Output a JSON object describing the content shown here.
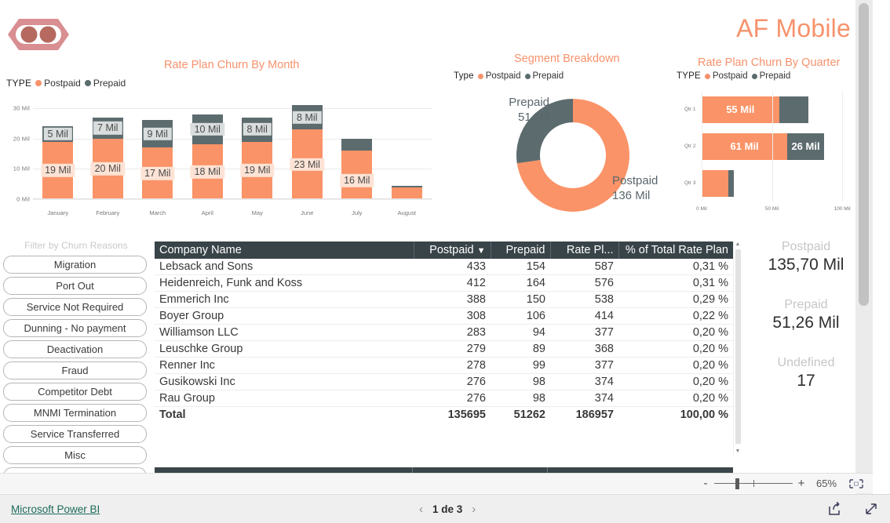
{
  "brand": {
    "title": "AF Mobile",
    "logo_icon": "af-mobile-logo-icon"
  },
  "charts": {
    "column": {
      "title": "Rate Plan Churn By Month",
      "legend_caption": "TYPE",
      "legend": [
        "Postpaid",
        "Prepaid"
      ]
    },
    "donut": {
      "title": "Segment Breakdown",
      "legend_caption": "Type",
      "legend": [
        "Postpaid",
        "Prepaid"
      ],
      "callout_left_name": "Prepaid",
      "callout_left_value": "51 Mil",
      "callout_right_name": "Postpaid",
      "callout_right_value": "136 Mil"
    },
    "quarter": {
      "title": "Rate Plan Churn By Quarter",
      "legend_caption": "TYPE",
      "legend": [
        "Postpaid",
        "Prepaid"
      ]
    }
  },
  "chart_data": [
    {
      "type": "bar",
      "name": "rate-plan-churn-by-month",
      "title": "Rate Plan Churn By Month",
      "stacked": true,
      "orientation": "vertical",
      "categories": [
        "January",
        "February",
        "March",
        "April",
        "May",
        "June",
        "July",
        "August"
      ],
      "series": [
        {
          "name": "Postpaid",
          "color": "#FA9367",
          "values": [
            19,
            20,
            17,
            18,
            19,
            23,
            16,
            4
          ],
          "labels": [
            "19 Mil",
            "20 Mil",
            "17 Mil",
            "18 Mil",
            "19 Mil",
            "23 Mil",
            "16 Mil",
            ""
          ]
        },
        {
          "name": "Prepaid",
          "color": "#5C6B6E",
          "values": [
            5,
            7,
            9,
            10,
            8,
            8,
            4,
            0.4
          ],
          "labels": [
            "5 Mil",
            "7 Mil",
            "9 Mil",
            "10 Mil",
            "8 Mil",
            "8 Mil",
            "",
            ""
          ]
        }
      ],
      "ylabel": "",
      "xlabel": "",
      "ylim": [
        0,
        30
      ],
      "yticks": [
        0,
        10,
        20,
        30
      ],
      "ytick_labels": [
        "0 Mil",
        "10 Mil",
        "20 Mil",
        "30 Mil"
      ],
      "grid": true,
      "legend_position": "top-left"
    },
    {
      "type": "pie",
      "name": "segment-breakdown",
      "title": "Segment Breakdown",
      "donut": true,
      "labels": [
        "Postpaid",
        "Prepaid"
      ],
      "values": [
        136,
        51
      ],
      "value_labels": [
        "136 Mil",
        "51 Mil"
      ],
      "colors": [
        "#FA9367",
        "#5C6B6E"
      ],
      "legend_position": "top-left"
    },
    {
      "type": "bar",
      "name": "rate-plan-churn-by-quarter",
      "title": "Rate Plan Churn By Quarter",
      "stacked": true,
      "orientation": "horizontal",
      "categories": [
        "Qtr 1",
        "Qtr 2",
        "Qtr 3"
      ],
      "series": [
        {
          "name": "Postpaid",
          "color": "#FA9367",
          "values": [
            55,
            61,
            19
          ],
          "labels": [
            "55 Mil",
            "61 Mil",
            ""
          ]
        },
        {
          "name": "Prepaid",
          "color": "#5C6B6E",
          "values": [
            21,
            26,
            4
          ],
          "labels": [
            "",
            "26 Mil",
            ""
          ]
        }
      ],
      "xlim": [
        0,
        110
      ],
      "xticks": [
        0,
        50,
        100
      ],
      "xtick_labels": [
        "0 Mil",
        "50 Mil",
        "100 Mil"
      ],
      "grid": true,
      "legend_position": "top-left"
    }
  ],
  "slicer": {
    "title": "Filter by Churn Reasons",
    "items": [
      "Migration",
      "Port Out",
      "Service Not Required",
      "Dunning - No payment",
      "Deactivation",
      "Fraud",
      "Competitor Debt",
      "MNMI Termination",
      "Service Transferred",
      "Misc"
    ]
  },
  "table": {
    "columns": [
      "Company Name",
      "Postpaid",
      "Prepaid",
      "Rate Pl...",
      "% of Total Rate Plan"
    ],
    "sorted_column": "Postpaid",
    "sort_direction": "desc",
    "rows": [
      {
        "company": "Lebsack and Sons",
        "postpaid": "433",
        "prepaid": "154",
        "rateplan": "587",
        "pct": "0,31 %"
      },
      {
        "company": "Heidenreich, Funk and Koss",
        "postpaid": "412",
        "prepaid": "164",
        "rateplan": "576",
        "pct": "0,31 %"
      },
      {
        "company": "Emmerich Inc",
        "postpaid": "388",
        "prepaid": "150",
        "rateplan": "538",
        "pct": "0,29 %"
      },
      {
        "company": "Boyer Group",
        "postpaid": "308",
        "prepaid": "106",
        "rateplan": "414",
        "pct": "0,22 %"
      },
      {
        "company": "Williamson LLC",
        "postpaid": "283",
        "prepaid": "94",
        "rateplan": "377",
        "pct": "0,20 %"
      },
      {
        "company": "Leuschke Group",
        "postpaid": "279",
        "prepaid": "89",
        "rateplan": "368",
        "pct": "0,20 %"
      },
      {
        "company": "Renner Inc",
        "postpaid": "278",
        "prepaid": "99",
        "rateplan": "377",
        "pct": "0,20 %"
      },
      {
        "company": "Gusikowski Inc",
        "postpaid": "276",
        "prepaid": "98",
        "rateplan": "374",
        "pct": "0,20 %"
      },
      {
        "company": "Rau Group",
        "postpaid": "276",
        "prepaid": "98",
        "rateplan": "374",
        "pct": "0,20 %"
      }
    ],
    "total": {
      "company": "Total",
      "postpaid": "135695",
      "prepaid": "51262",
      "rateplan": "186957",
      "pct": "100,00 %"
    }
  },
  "kpis": [
    {
      "label": "Postpaid",
      "value": "135,70 Mil"
    },
    {
      "label": "Prepaid",
      "value": "51,26 Mil"
    },
    {
      "label": "Undefined",
      "value": "17"
    }
  ],
  "zoombar": {
    "minus": "-",
    "plus": "+",
    "percent": "65%",
    "fit_icon": "fit-to-page-icon"
  },
  "footer": {
    "brand_link": "Microsoft Power BI",
    "prev_icon": "chevron-left-icon",
    "page_label": "1 de 3",
    "next_icon": "chevron-right-icon",
    "share_icon": "share-icon",
    "fullscreen_icon": "fullscreen-icon"
  },
  "colors": {
    "accent": "#F7926C",
    "postpaid": "#FA9367",
    "prepaid": "#5C6B6E",
    "header": "#394449"
  }
}
